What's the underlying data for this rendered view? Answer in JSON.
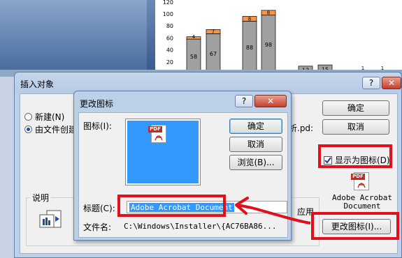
{
  "chart_data": {
    "type": "bar",
    "y_ticks": [
      "120",
      "100",
      "80",
      "60",
      "40",
      "20"
    ],
    "bars": [
      {
        "value_label": "58",
        "top_label": "4",
        "value": 58,
        "top": 4
      },
      {
        "value_label": "67",
        "top_label": "7",
        "value": 67,
        "top": 7
      },
      {
        "value_label": "88",
        "top_label": "8",
        "value": 88,
        "top": 8
      },
      {
        "value_label": "98",
        "top_label": "8",
        "value": 98,
        "top": 8
      },
      {
        "value_label": "13",
        "top_label": "",
        "value": 13,
        "top": 0
      },
      {
        "value_label": "15",
        "top_label": "",
        "value": 15,
        "top": 0
      },
      {
        "value_label": "",
        "top_label": "1",
        "value": 0,
        "top": 1
      },
      {
        "value_label": "",
        "top_label": "1",
        "value": 0,
        "top": 1
      }
    ],
    "ylim": [
      0,
      120
    ],
    "colors": {
      "base": "#a0a0a0",
      "top": "#f79646",
      "new": "#92d050"
    }
  },
  "insert_dialog": {
    "title": "插入对象",
    "help": "?",
    "close": "✕",
    "radio_new": "新建(N)",
    "radio_from_file": "由文件创建",
    "file_fragment": "析.pd:",
    "ok": "确定",
    "cancel": "取消",
    "display_as_icon": "显示为图标(D)",
    "icon_caption_line1": "Adobe Acrobat",
    "icon_caption_line2": "Document",
    "description_label": "说明",
    "result_fragment": "应用",
    "change_icon": "更改图标(I)..."
  },
  "change_icon_dialog": {
    "title": "更改图标",
    "help": "?",
    "close": "✕",
    "icon_label": "图标(I):",
    "ok": "确定",
    "cancel": "取消",
    "browse": "浏览(B)...",
    "caption_label": "标题(C):",
    "caption_value": "Adobe Acrobat Document",
    "filename_label": "文件名:",
    "filename_value": "C:\\Windows\\Installer\\{AC76BA86..."
  },
  "pdf_tag": "PDF",
  "colors": {
    "highlight": "#e0101c",
    "selection": "#3399ff"
  }
}
